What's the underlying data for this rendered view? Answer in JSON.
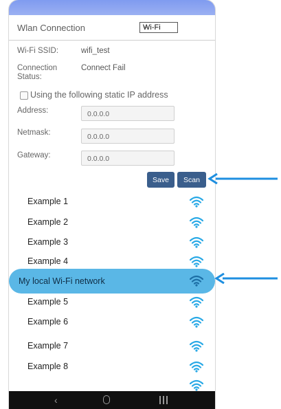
{
  "header": {
    "title": "Wlan Connection",
    "mode_select": "Wi-Fi"
  },
  "fields": {
    "ssid_label": "Wi-Fi SSID:",
    "ssid_value": "wifi_test",
    "status_label": "Connection\nStatus:",
    "status_value": "Connect Fail"
  },
  "static_ip": {
    "checkbox_label": "Using the following static IP address",
    "checked": false,
    "address_label": "Address:",
    "address_value": "0.0.0.0",
    "netmask_label": "Netmask:",
    "netmask_value": "0.0.0.0",
    "gateway_label": "Gateway:",
    "gateway_value": "0.0.0.0"
  },
  "buttons": {
    "save": "Save",
    "scan": "Scan"
  },
  "networks": [
    {
      "name": "Example 1"
    },
    {
      "name": "Example 2"
    },
    {
      "name": "Example 3"
    },
    {
      "name": "Example 4"
    },
    {
      "name": "My local Wi-Fi network",
      "selected": true
    },
    {
      "name": "Example 5"
    },
    {
      "name": "Example 6"
    },
    {
      "name": "Example 7"
    },
    {
      "name": "Example 8"
    },
    {
      "name": ""
    }
  ],
  "nav": {
    "back_icon": "back-icon",
    "home_icon": "home-icon",
    "recent_icon": "recent-apps-icon"
  },
  "colors": {
    "accent_button": "#3a5e8c",
    "selected_row": "#5ab7e6",
    "wifi_icon": "#29a9e6",
    "arrow": "#1e8fe0",
    "topbar": "#8fa6f1"
  }
}
